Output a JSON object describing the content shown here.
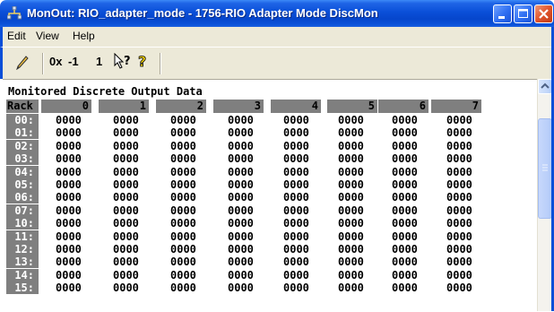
{
  "window": {
    "title": "MonOut: RIO_adapter_mode - 1756-RIO Adapter Mode DiscMon"
  },
  "menu": {
    "items": [
      "Edit",
      "View",
      "Help"
    ]
  },
  "toolbar": {
    "hex_label": "0x",
    "minus_one_label": "-1",
    "one_label": "1"
  },
  "main": {
    "heading": "Monitored Discrete Output Data",
    "rack_label": "Rack",
    "columns": [
      "0",
      "1",
      "2",
      "3",
      "4",
      "5",
      "6",
      "7"
    ],
    "rows": [
      {
        "label": "00:",
        "values": [
          "0000",
          "0000",
          "0000",
          "0000",
          "0000",
          "0000",
          "0000",
          "0000"
        ]
      },
      {
        "label": "01:",
        "values": [
          "0000",
          "0000",
          "0000",
          "0000",
          "0000",
          "0000",
          "0000",
          "0000"
        ]
      },
      {
        "label": "02:",
        "values": [
          "0000",
          "0000",
          "0000",
          "0000",
          "0000",
          "0000",
          "0000",
          "0000"
        ]
      },
      {
        "label": "03:",
        "values": [
          "0000",
          "0000",
          "0000",
          "0000",
          "0000",
          "0000",
          "0000",
          "0000"
        ]
      },
      {
        "label": "04:",
        "values": [
          "0000",
          "0000",
          "0000",
          "0000",
          "0000",
          "0000",
          "0000",
          "0000"
        ]
      },
      {
        "label": "05:",
        "values": [
          "0000",
          "0000",
          "0000",
          "0000",
          "0000",
          "0000",
          "0000",
          "0000"
        ]
      },
      {
        "label": "06:",
        "values": [
          "0000",
          "0000",
          "0000",
          "0000",
          "0000",
          "0000",
          "0000",
          "0000"
        ]
      },
      {
        "label": "07:",
        "values": [
          "0000",
          "0000",
          "0000",
          "0000",
          "0000",
          "0000",
          "0000",
          "0000"
        ]
      },
      {
        "label": "10:",
        "values": [
          "0000",
          "0000",
          "0000",
          "0000",
          "0000",
          "0000",
          "0000",
          "0000"
        ]
      },
      {
        "label": "11:",
        "values": [
          "0000",
          "0000",
          "0000",
          "0000",
          "0000",
          "0000",
          "0000",
          "0000"
        ]
      },
      {
        "label": "12:",
        "values": [
          "0000",
          "0000",
          "0000",
          "0000",
          "0000",
          "0000",
          "0000",
          "0000"
        ]
      },
      {
        "label": "13:",
        "values": [
          "0000",
          "0000",
          "0000",
          "0000",
          "0000",
          "0000",
          "0000",
          "0000"
        ]
      },
      {
        "label": "14:",
        "values": [
          "0000",
          "0000",
          "0000",
          "0000",
          "0000",
          "0000",
          "0000",
          "0000"
        ]
      },
      {
        "label": "15:",
        "values": [
          "0000",
          "0000",
          "0000",
          "0000",
          "0000",
          "0000",
          "0000",
          "0000"
        ]
      }
    ]
  },
  "icons": {
    "app": "network-app-icon",
    "pencil": "pencil-icon",
    "context_help": "context-help-arrow-icon",
    "help": "help-question-icon"
  },
  "colors": {
    "titlebar": "#0a4fd8",
    "header_gray": "#7f7f7f",
    "chrome": "#ece9d8"
  }
}
